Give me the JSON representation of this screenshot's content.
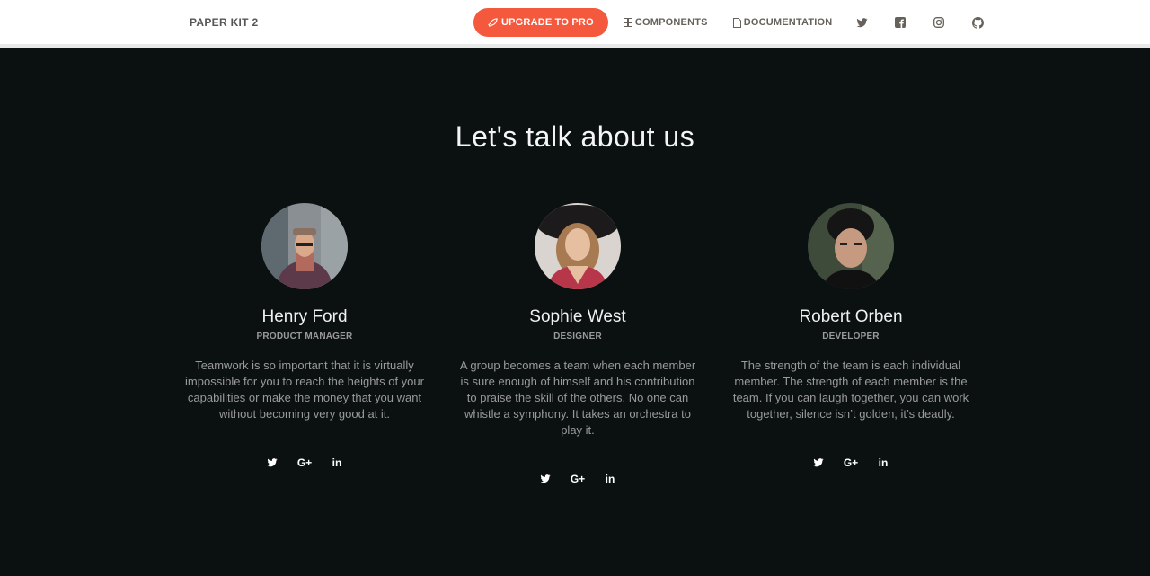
{
  "navbar": {
    "brand": "PAPER KIT 2",
    "upgrade_label": "UPGRADE TO PRO",
    "components_label": "COMPONENTS",
    "documentation_label": "DOCUMENTATION",
    "social_icons": [
      "twitter-icon",
      "facebook-icon",
      "instagram-icon",
      "github-icon"
    ]
  },
  "section": {
    "title": "Let's talk about us"
  },
  "team": [
    {
      "name": "Henry Ford",
      "role": "PRODUCT MANAGER",
      "description": "Teamwork is so important that it is virtually impossible for you to reach the heights of your capabilities or make the money that you want without becoming very good at it.",
      "socials": [
        "twitter-icon",
        "google-plus-icon",
        "linkedin-icon"
      ]
    },
    {
      "name": "Sophie West",
      "role": "DESIGNER",
      "description": "A group becomes a team when each member is sure enough of himself and his contribution to praise the skill of the others. No one can whistle a symphony. It takes an orchestra to play it.",
      "socials": [
        "twitter-icon",
        "google-plus-icon",
        "linkedin-icon"
      ]
    },
    {
      "name": "Robert Orben",
      "role": "DEVELOPER",
      "description": "The strength of the team is each individual member. The strength of each member is the team. If you can laugh together, you can work together, silence isn’t golden, it’s deadly.",
      "socials": [
        "twitter-icon",
        "google-plus-icon",
        "linkedin-icon"
      ]
    }
  ],
  "colors": {
    "accent": "#f5593d",
    "background": "#0b1011",
    "navbar_bg": "#ffffff"
  }
}
